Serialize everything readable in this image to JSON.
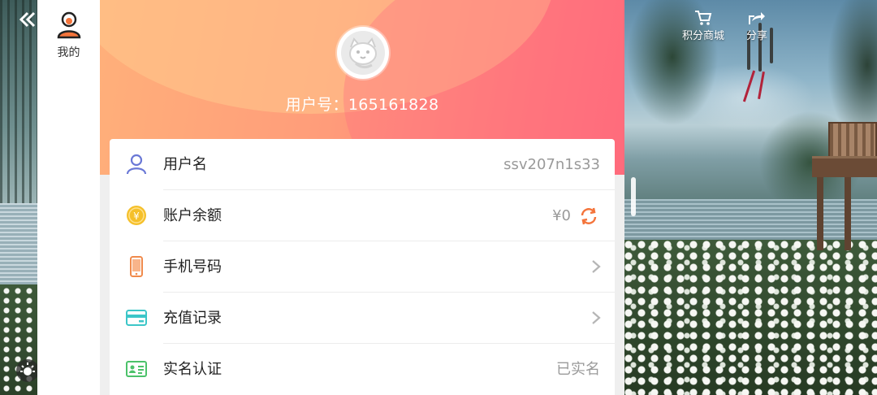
{
  "nav": {
    "back_icon": "chevron-double-left-icon",
    "items": [
      {
        "label": "我的",
        "icon": "user-icon"
      }
    ],
    "settings_icon": "sun-settings-icon"
  },
  "profile": {
    "avatar_icon": "cat-avatar-icon",
    "user_id_label": "用户号：165161828"
  },
  "account_rows": [
    {
      "label": "用户名",
      "value": "ssv207n1s33",
      "icon": "person-outline-icon"
    },
    {
      "label": "账户余额",
      "value": "¥0",
      "icon": "yuan-coin-icon",
      "action_icon": "refresh-icon"
    },
    {
      "label": "手机号码",
      "icon": "phone-icon",
      "action_icon": "chevron-right-icon"
    },
    {
      "label": "充值记录",
      "icon": "card-icon",
      "action_icon": "chevron-right-icon"
    },
    {
      "label": "实名认证",
      "value": "已实名",
      "icon": "id-card-icon"
    }
  ],
  "top_actions": [
    {
      "label": "积分商城",
      "icon": "cart-icon"
    },
    {
      "label": "分享",
      "icon": "share-icon"
    }
  ],
  "colors": {
    "hero_start": "#ffb07a",
    "hero_end": "#ff6a7a",
    "accent_orange": "#f4743b",
    "coin": "#f5c02a",
    "phone": "#f08a4b",
    "card": "#3cc6c8",
    "id_card": "#4cc26a",
    "user_icon": "#6a78d6"
  }
}
